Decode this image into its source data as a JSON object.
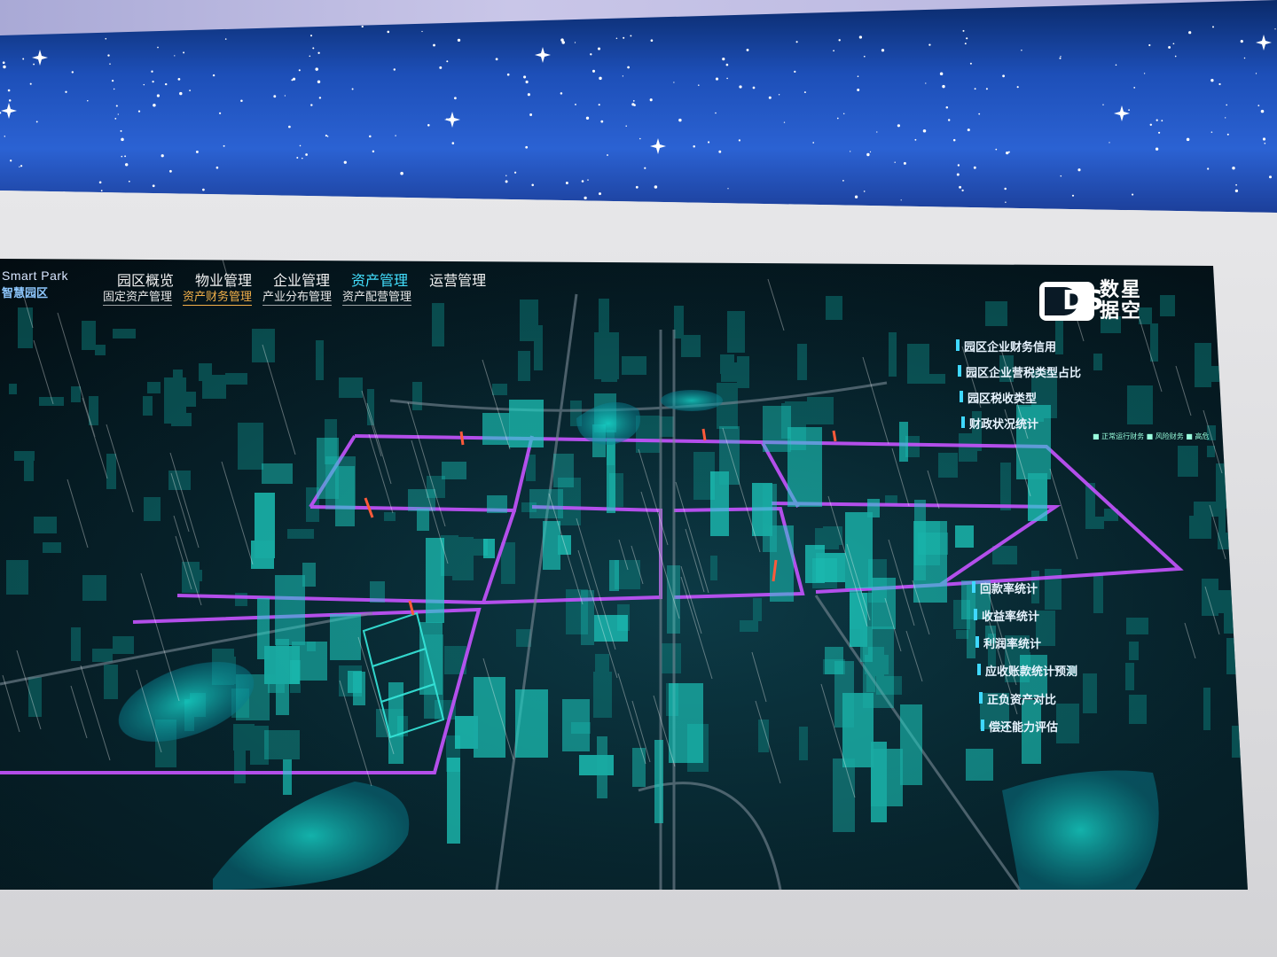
{
  "header": {
    "logo_en": "Smart Park",
    "logo_cn": "智慧园区"
  },
  "nav": {
    "main": [
      "园区概览",
      "物业管理",
      "企业管理",
      "资产管理",
      "运营管理"
    ],
    "main_active": "资产管理",
    "sub": [
      "固定资产管理",
      "资产财务管理",
      "产业分布管理",
      "资产配营管理"
    ],
    "sub_active": "资产财务管理"
  },
  "brand": {
    "mark": "DS",
    "line1": "数星",
    "line2": "据空"
  },
  "right_menu_top": [
    "园区企业财务信用",
    "园区企业营税类型占比",
    "园区税收类型",
    "财政状况统计"
  ],
  "right_menu_bottom": [
    "回款率统计",
    "收益率统计",
    "利润率统计",
    "应收账款统计预测",
    "正负资产对比",
    "偿还能力评估"
  ],
  "legend_strip": "■ 正常运行财务 ■ 风险财务 ■ 高危",
  "colors": {
    "accent_cyan": "#43e0ff",
    "accent_orange": "#f3b04a",
    "road_magenta": "#c653ff",
    "building_teal": "#1fd6c8"
  }
}
